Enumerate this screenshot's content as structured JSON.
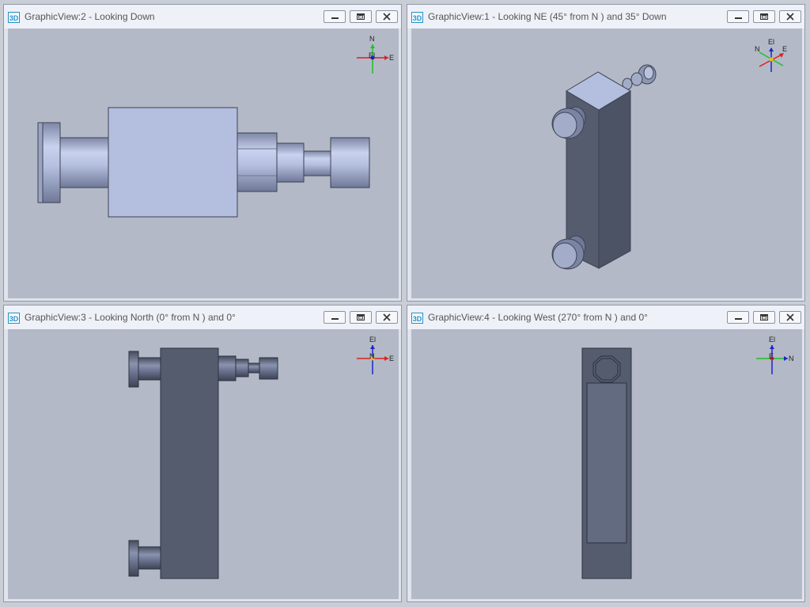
{
  "windows": [
    {
      "id": "2",
      "title": "GraphicView:2 - Looking Down",
      "badge": "3D",
      "compass": {
        "up": "N",
        "right": "E",
        "center": "El"
      }
    },
    {
      "id": "1",
      "title": "GraphicView:1 - Looking NE (45° from N ) and 35° Down",
      "badge": "3D",
      "compass": {
        "up": "El",
        "left": "N",
        "right": "E"
      }
    },
    {
      "id": "3",
      "title": "GraphicView:3 - Looking North (0° from N ) and 0°",
      "badge": "3D",
      "compass": {
        "up": "El",
        "right": "E",
        "center": "N"
      }
    },
    {
      "id": "4",
      "title": "GraphicView:4 - Looking West (270° from N ) and 0°",
      "badge": "3D",
      "compass": {
        "up": "El",
        "right": "N",
        "center": "E"
      }
    }
  ],
  "colors": {
    "viewport_bg": "#b3b9c7",
    "part_light": "#b4bede",
    "part_dark": "#545c6e",
    "axis_red": "#e0201c",
    "axis_green": "#1fc02c",
    "axis_blue": "#1a24c8"
  },
  "icons": [
    "minimize-icon",
    "restore-icon",
    "close-icon"
  ]
}
